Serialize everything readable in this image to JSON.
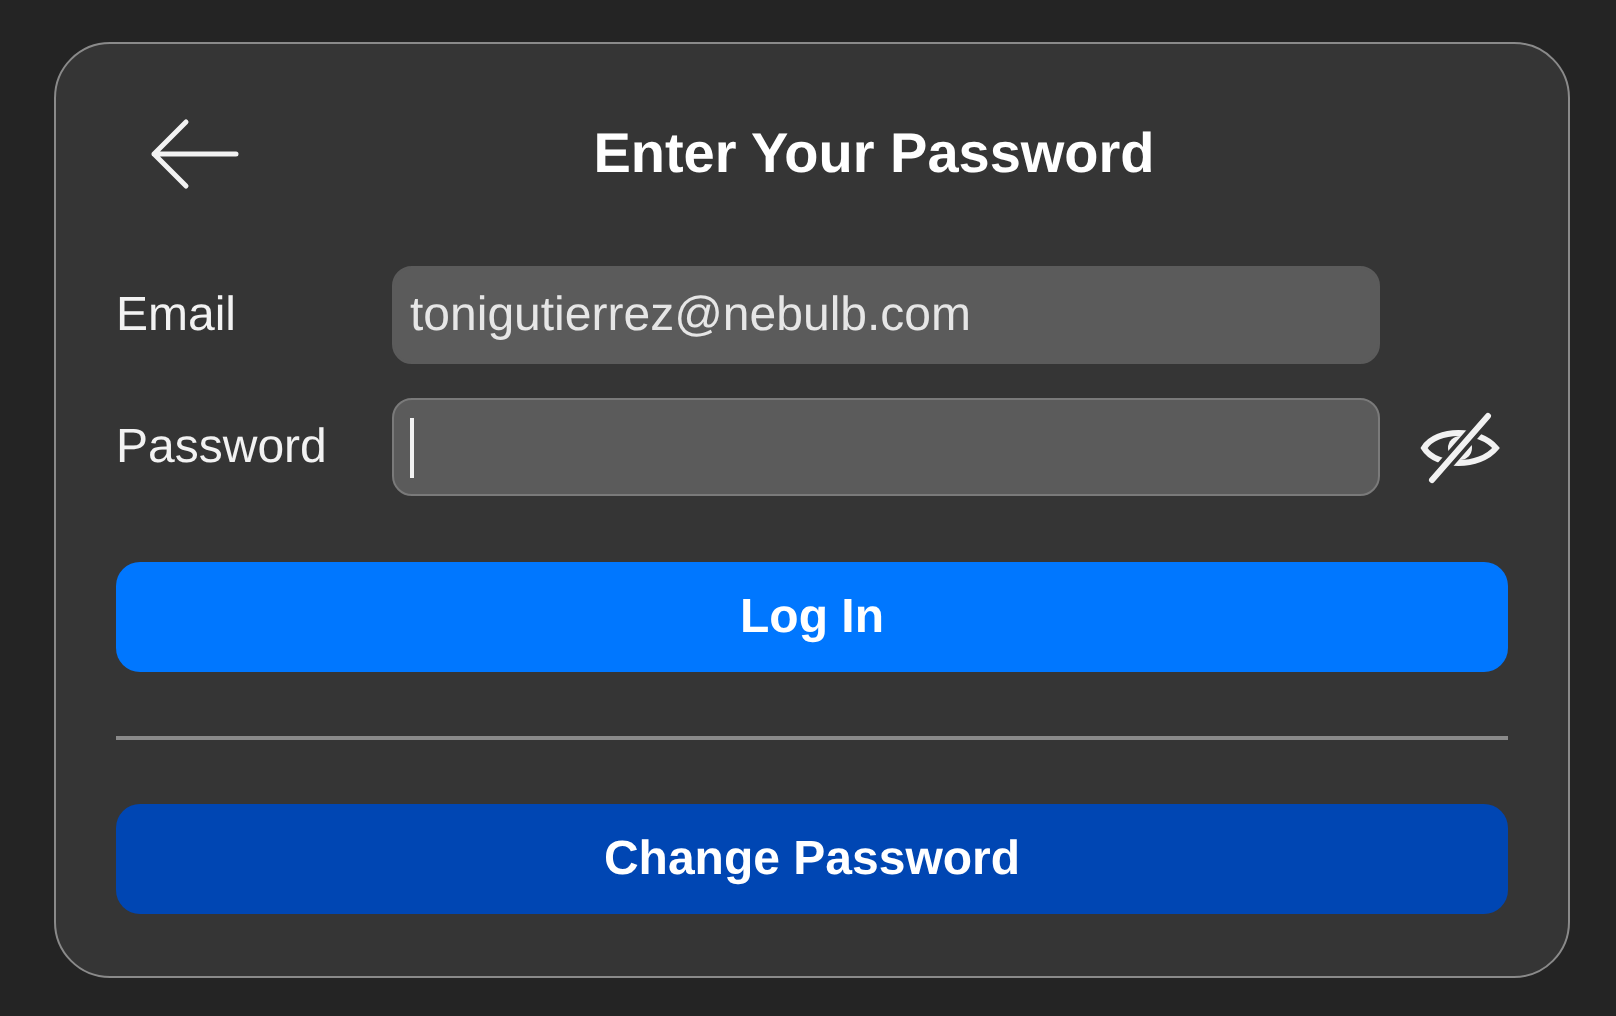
{
  "title": "Enter Your Password",
  "fields": [
    {
      "kind": "email",
      "label": "Email",
      "value": "tonigutierrez@nebulb.com",
      "focused": false
    },
    {
      "kind": "password",
      "label": "Password",
      "focused": true,
      "show_password": false
    }
  ],
  "buttons": [
    {
      "label": "Log In",
      "kind": "primary"
    },
    {
      "label": "Change Password",
      "kind": "secondary"
    }
  ]
}
